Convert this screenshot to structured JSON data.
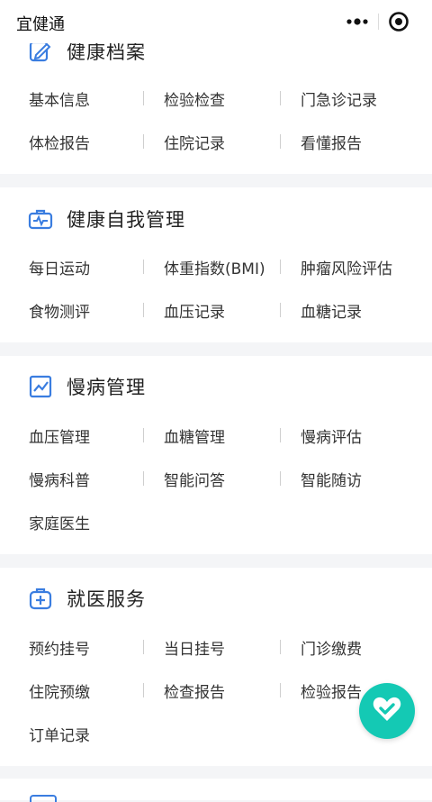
{
  "app": {
    "title": "宜健通"
  },
  "colors": {
    "accent": "#3a7de0",
    "fab": "#14c9b4",
    "background": "#f4f5f7"
  },
  "sections": {
    "health_records": {
      "title": "健康档案",
      "icon": "record-edit-icon",
      "rows": [
        [
          "基本信息",
          "检验检查",
          "门急诊记录"
        ],
        [
          "体检报告",
          "住院记录",
          "看懂报告"
        ]
      ]
    },
    "self_management": {
      "title": "健康自我管理",
      "icon": "medical-kit-icon",
      "rows": [
        [
          "每日运动",
          "体重指数(BMI)",
          "肿瘤风险评估"
        ],
        [
          "食物测评",
          "血压记录",
          "血糖记录"
        ]
      ]
    },
    "chronic": {
      "title": "慢病管理",
      "icon": "trend-chart-icon",
      "rows": [
        [
          "血压管理",
          "血糖管理",
          "慢病评估"
        ],
        [
          "慢病科普",
          "智能问答",
          "智能随访"
        ],
        [
          "家庭医生"
        ]
      ]
    },
    "medical_service": {
      "title": "就医服务",
      "icon": "medical-bag-icon",
      "rows": [
        [
          "预约挂号",
          "当日挂号",
          "门诊缴费"
        ],
        [
          "住院预缴",
          "检查报告",
          "检验报告"
        ],
        [
          "订单记录"
        ]
      ]
    }
  },
  "fab": {
    "icon": "heart-check-icon"
  }
}
